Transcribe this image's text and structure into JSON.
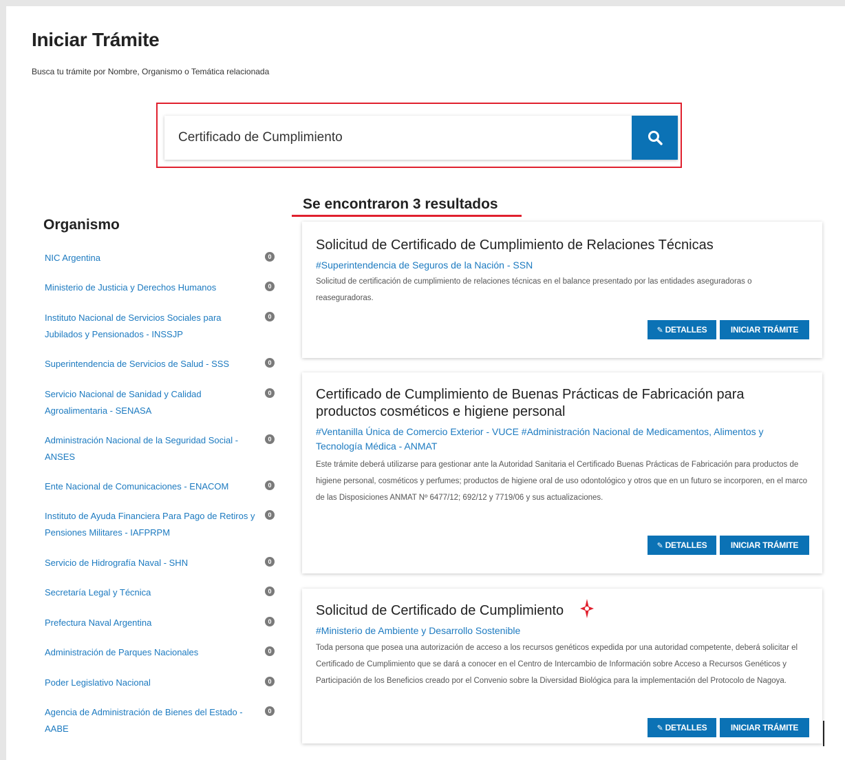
{
  "page": {
    "title": "Iniciar Trámite",
    "subtitle": "Busca tu trámite por Nombre, Organismo o Temática relacionada"
  },
  "search": {
    "value": "Certificado de Cumplimiento",
    "button_icon": "search-icon"
  },
  "results": {
    "title": "Se encontraron 3 resultados"
  },
  "sidebar": {
    "title": "Organismo",
    "items": [
      {
        "label": "NIC Argentina",
        "count": "0"
      },
      {
        "label": "Ministerio de Justicia y Derechos Humanos",
        "count": "0"
      },
      {
        "label": "Instituto Nacional de Servicios Sociales para Jubilados y Pensionados - INSSJP",
        "count": "0"
      },
      {
        "label": "Superintendencia de Servicios de Salud - SSS",
        "count": "0"
      },
      {
        "label": "Servicio Nacional de Sanidad y Calidad Agroalimentaria - SENASA",
        "count": "0"
      },
      {
        "label": "Administración Nacional de la Seguridad Social - ANSES",
        "count": "0"
      },
      {
        "label": "Ente Nacional de Comunicaciones - ENACOM",
        "count": "0"
      },
      {
        "label": "Instituto de Ayuda Financiera Para Pago de Retiros y Pensiones Militares - IAFPRPM",
        "count": "0"
      },
      {
        "label": "Servicio de Hidrografía Naval - SHN",
        "count": "0"
      },
      {
        "label": "Secretaría Legal y Técnica",
        "count": "0"
      },
      {
        "label": "Prefectura Naval Argentina",
        "count": "0"
      },
      {
        "label": "Administración de Parques Nacionales",
        "count": "0"
      },
      {
        "label": "Poder Legislativo Nacional",
        "count": "0"
      },
      {
        "label": "Agencia de Administración de Bienes del Estado - AABE",
        "count": "0"
      }
    ]
  },
  "cards": [
    {
      "title": "Solicitud de Certificado de Cumplimiento de Relaciones Técnicas",
      "org": "#Superintendencia de Seguros de la Nación - SSN",
      "description": "Solicitud de certificación de cumplimiento de relaciones técnicas en el balance presentado por las entidades aseguradoras o reaseguradoras."
    },
    {
      "title": "Certificado de Cumplimiento de Buenas Prácticas de Fabricación para productos cosméticos e higiene personal",
      "org": "#Ventanilla Única de Comercio Exterior - VUCE #Administración Nacional de Medicamentos, Alimentos y Tecnología Médica - ANMAT",
      "description": "Este trámite deberá utilizarse para gestionar ante la Autoridad Sanitaria el Certificado Buenas Prácticas de Fabricación para productos de higiene personal, cosméticos y perfumes; productos de higiene oral de uso odontológico y otros que en un futuro se incorporen, en el marco de las Disposiciones ANMAT Nº 6477/12; 692/12 y 7719/06 y sus actualizaciones."
    },
    {
      "title": "Solicitud de Certificado de Cumplimiento",
      "org": "#Ministerio de Ambiente y Desarrollo Sostenible",
      "description": "Toda persona que posea una autorización de acceso a los recursos genéticos expedida por una autoridad competente, deberá solicitar el Certificado de Cumplimiento que se dará a conocer en el Centro de Intercambio de Información sobre Acceso a Recursos Genéticos y Participación de los Beneficios creado por el Convenio sobre la Diversidad Biológica para la implementación del Protocolo de Nagoya."
    }
  ],
  "buttons": {
    "details": "DETALLES",
    "start": "INICIAR TRÁMITE"
  },
  "colors": {
    "primary": "#0b72b5",
    "link": "#1c7ac0",
    "highlight": "#e0202e"
  }
}
